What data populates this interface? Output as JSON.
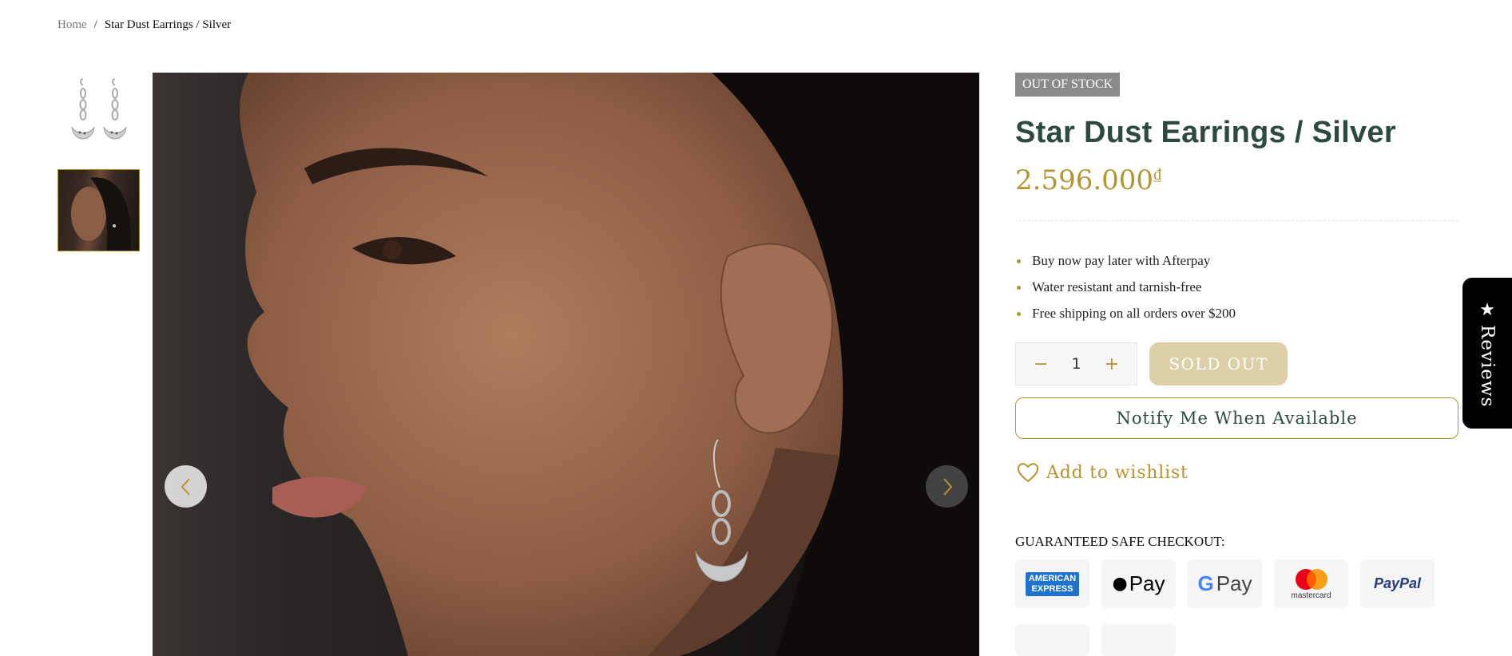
{
  "breadcrumb": {
    "home": "Home",
    "separator": "/",
    "current": "Star Dust Earrings / Silver"
  },
  "gallery": {
    "thumbnails": [
      {
        "alt": "earrings-product-shot"
      },
      {
        "alt": "model-wearing-earring"
      }
    ],
    "active_index": 1
  },
  "product": {
    "badge": "OUT OF STOCK",
    "title": "Star Dust Earrings / Silver",
    "price": "2.596.000",
    "currency_symbol": "₫",
    "features": [
      "Buy now pay later with Afterpay",
      "Water resistant and tarnish-free",
      "Free shipping on all orders over $200"
    ],
    "quantity": "1",
    "qty_minus": "−",
    "qty_plus": "+",
    "sold_out_label": "SOLD OUT",
    "notify_label": "Notify Me When Available",
    "wishlist_label": "Add to wishlist"
  },
  "checkout": {
    "heading": "GUARANTEED SAFE CHECKOUT:",
    "payment_methods": [
      "American Express",
      "Apple Pay",
      "Google Pay",
      "Mastercard",
      "PayPal"
    ],
    "amex_line1": "AMERICAN",
    "amex_line2": "EXPRESS",
    "apple_pay": "Pay",
    "google_pay": "Pay",
    "mastercard": "mastercard",
    "paypal": "PayPal"
  },
  "reviews_tab": {
    "label": "Reviews"
  },
  "colors": {
    "accent_gold": "#b5952f",
    "title_green": "#2d4a3e",
    "badge_gray": "#8a8a8a",
    "sold_out_bg": "#ddd0a8"
  }
}
